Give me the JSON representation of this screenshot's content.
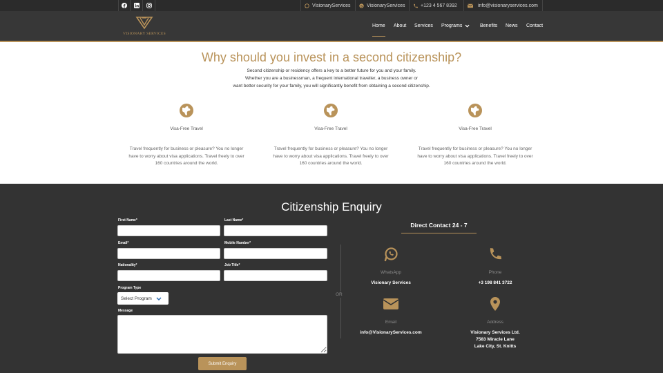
{
  "topbar": {
    "social": [
      "facebook-icon",
      "linkedin-icon",
      "instagram-icon"
    ],
    "whatsapp": "VisionaryServices",
    "skype": "VisionaryServices",
    "phone": "+123 4 567 8392",
    "email": "info@visionaryservices.com"
  },
  "header": {
    "logo_text": "VISIONARY SERVICES",
    "nav": [
      "Home",
      "About",
      "Services",
      "Programs",
      "Benefits",
      "News",
      "Contact"
    ]
  },
  "why": {
    "title": "Why should you invest in a second citizenship?",
    "intro": [
      "Second citizenship or residency offers a key to a better future for you and your family.",
      "Whether you are a businessman, a frequent international traveller, a business owner or",
      "want better security for your family, you will significantly benefit from obtaining a second citizenship."
    ],
    "features": [
      {
        "title": "Visa-Free Travel",
        "desc": "Travel frequently for business or pleasure? You no longer have to worry about visa applications. Travel freely to over 160 countries around the world."
      },
      {
        "title": "Visa-Free Travel",
        "desc": "Travel frequently for business or pleasure? You no longer have to worry about visa applications. Travel freely to over 160 countries around the world."
      },
      {
        "title": "Visa-Free Travel",
        "desc": "Travel frequently for business or pleasure? You no longer have to worry about visa applications. Travel freely to over 160 countries around the world."
      }
    ]
  },
  "enquiry": {
    "title": "Citizenship Enquiry",
    "first_name": "First Name*",
    "last_name": "Last Name*",
    "email": "Email*",
    "mobile": "Mobile Number*",
    "nationality": "Nationality*",
    "job_title": "Job Title*",
    "program_type": "Program Type",
    "select_program": "Select Program",
    "message": "Message",
    "submit": "Submit Enquiry",
    "or": "OR"
  },
  "direct": {
    "title": "Direct Contact 24 - 7",
    "whatsapp_label": "WhatsApp",
    "whatsapp_value": "Visionary Services",
    "phone_label": "Phone",
    "phone_value": "+3 198 841 3722",
    "email_label": "Email",
    "email_value": "info@VisionaryServices.com",
    "address_label": "Address",
    "address_lines": [
      "Visionary Services Ltd.",
      "7583 Miracle Lane",
      "Lake City, St. Knitts"
    ]
  },
  "colors": {
    "accent": "#b9935a",
    "dark": "#333333",
    "topbar": "#2b2b2b"
  }
}
